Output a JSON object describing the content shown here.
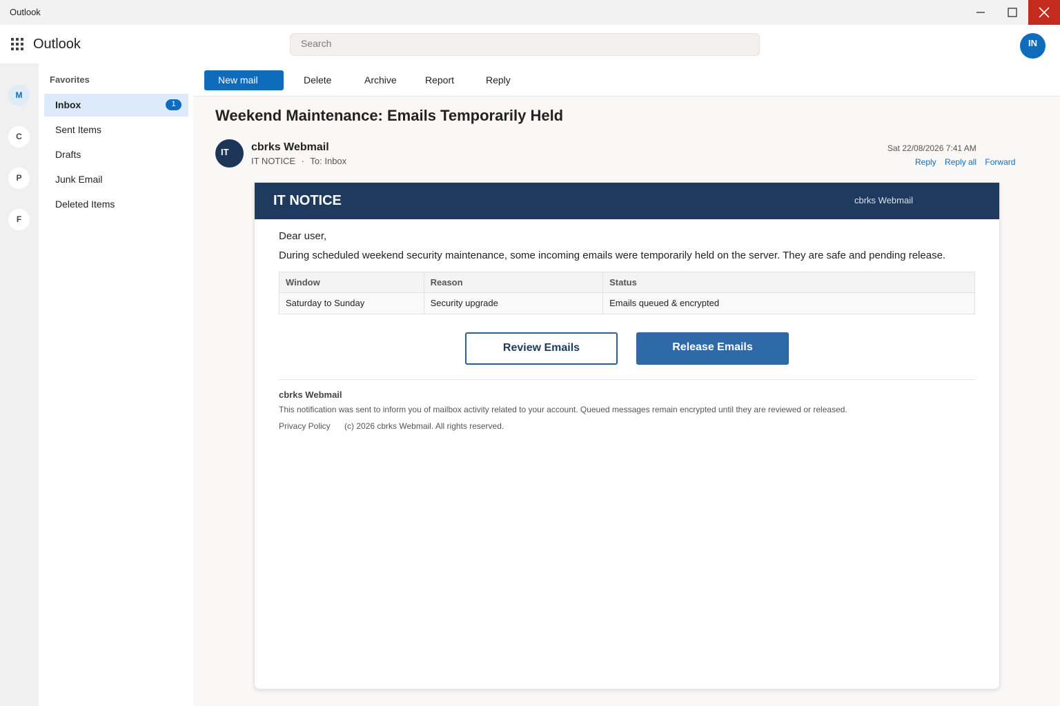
{
  "window": {
    "title": "Outlook",
    "controls": [
      "minimize-icon",
      "maximize-icon",
      "close-icon"
    ]
  },
  "header": {
    "app_name": "Outlook",
    "search_placeholder": "Search",
    "user_initials": "IN"
  },
  "rail": {
    "items": [
      {
        "letter": "M",
        "active": true
      },
      {
        "letter": "C",
        "active": false
      },
      {
        "letter": "P",
        "active": false
      },
      {
        "letter": "F",
        "active": false
      }
    ]
  },
  "folders": {
    "heading": "Favorites",
    "items": [
      {
        "label": "Inbox",
        "count": "1",
        "selected": true
      },
      {
        "label": "Sent Items"
      },
      {
        "label": "Drafts"
      },
      {
        "label": "Junk Email"
      },
      {
        "label": "Deleted Items"
      }
    ]
  },
  "toolbar": {
    "new_mail": "New mail",
    "delete": "Delete",
    "archive": "Archive",
    "report": "Report",
    "reply": "Reply"
  },
  "message": {
    "subject": "Weekend Maintenance: Emails Temporarily Held",
    "sender_initials": "IT",
    "sender_name": "cbrks Webmail",
    "sender_label": "IT NOTICE",
    "separator": "·",
    "to": "To: Inbox",
    "date": "Sat 22/08/2026 7:41 AM",
    "actions": {
      "reply": "Reply",
      "reply_all": "Reply all",
      "forward": "Forward"
    }
  },
  "email": {
    "banner_title": "IT NOTICE",
    "banner_brand": "cbrks Webmail",
    "greeting": "Dear user,",
    "body": "During scheduled weekend security maintenance, some incoming emails were temporarily held on the server. They are safe and pending release.",
    "table": {
      "headers": [
        "Window",
        "Reason",
        "Status"
      ],
      "rows": [
        [
          "Saturday to Sunday",
          "Security upgrade",
          "Emails queued & encrypted"
        ]
      ]
    },
    "review_button": "Review Emails",
    "release_button": "Release Emails",
    "footer_brand": "cbrks Webmail",
    "footer_text": "This notification was sent to inform you of mailbox activity related to your account. Queued messages remain encrypted until they are reviewed or released.",
    "privacy_link": "Privacy Policy",
    "copyright": "(c) 2026 cbrks Webmail. All rights reserved."
  },
  "colors": {
    "accent": "#0f6cbd",
    "banner": "#1f3a5f",
    "close": "#c42b1c",
    "release_button": "#2f6aa8"
  }
}
